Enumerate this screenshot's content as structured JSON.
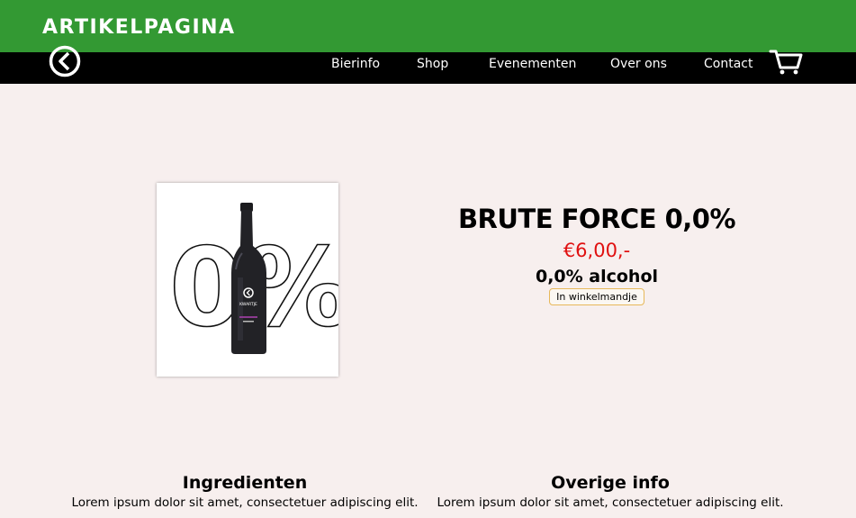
{
  "banner": {
    "title": "ARTIKELPAGINA"
  },
  "nav": {
    "items": [
      {
        "label": "Bierinfo"
      },
      {
        "label": "Shop"
      },
      {
        "label": "Evenementen"
      },
      {
        "label": "Over ons"
      },
      {
        "label": "Contact"
      }
    ],
    "logo_icon": "logo-icon",
    "cart_icon": "cart-icon"
  },
  "product": {
    "name": "BRUTE FORCE 0,0%",
    "price": "€6,00,-",
    "alcohol": "0,0% alcohol",
    "cart_button_label": "In winkelmandje",
    "image_text": "0%",
    "bottle_label": "KWARTJE"
  },
  "sections": [
    {
      "title": "Ingredienten",
      "text": "Lorem ipsum dolor sit amet, consectetuer adipiscing elit."
    },
    {
      "title": "Overige info",
      "text": "Lorem ipsum dolor sit amet, consectetuer adipiscing elit."
    }
  ],
  "colors": {
    "banner": "#339933",
    "navbar": "#000000",
    "background": "#f7efee",
    "price": "#e01010",
    "button_border": "#e7b85a"
  }
}
